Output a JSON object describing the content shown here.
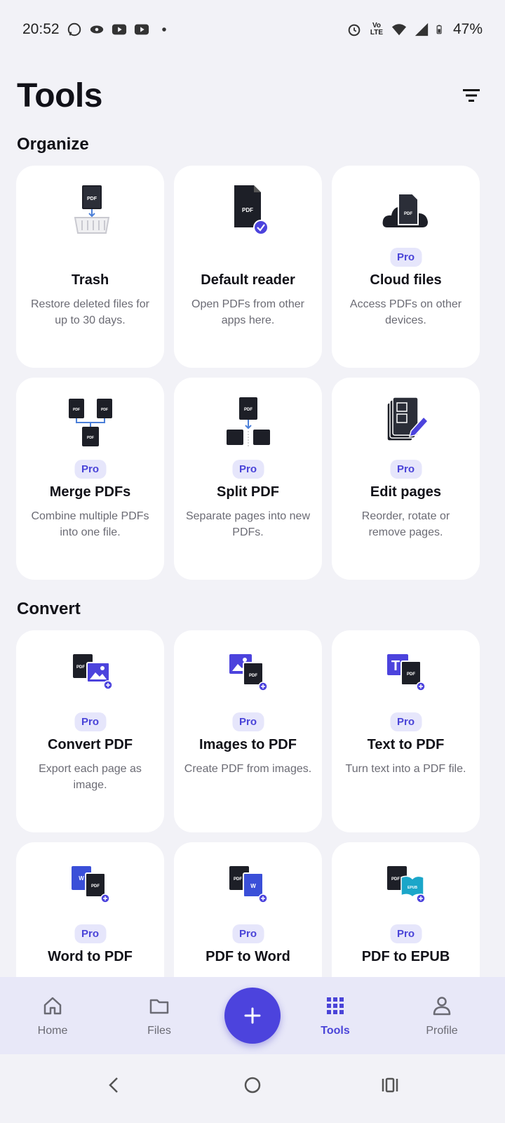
{
  "status": {
    "time": "20:52",
    "battery": "47%",
    "net": "Vo LTE"
  },
  "header": {
    "title": "Tools"
  },
  "sections": {
    "organize": "Organize",
    "convert": "Convert"
  },
  "pro_label": "Pro",
  "organize": [
    {
      "name": "Trash",
      "desc": "Restore deleted files for up to 30 days.",
      "icon": "trash-pdf-icon",
      "pro": false
    },
    {
      "name": "Default reader",
      "desc": "Open PDFs from other apps here.",
      "icon": "default-reader-icon",
      "pro": false
    },
    {
      "name": "Cloud files",
      "desc": "Access PDFs on other devices.",
      "icon": "cloud-pdf-icon",
      "pro": true
    },
    {
      "name": "Merge PDFs",
      "desc": "Combine multiple PDFs into one file.",
      "icon": "merge-pdf-icon",
      "pro": true
    },
    {
      "name": "Split PDF",
      "desc": "Separate pages into new PDFs.",
      "icon": "split-pdf-icon",
      "pro": true
    },
    {
      "name": "Edit pages",
      "desc": "Reorder, rotate or remove pages.",
      "icon": "edit-pages-icon",
      "pro": true
    }
  ],
  "convert": [
    {
      "name": "Convert PDF",
      "desc": "Export each page as image.",
      "icon": "pdf-to-image-icon",
      "pro": true
    },
    {
      "name": "Images to PDF",
      "desc": "Create PDF from images.",
      "icon": "image-to-pdf-icon",
      "pro": true
    },
    {
      "name": "Text to PDF",
      "desc": "Turn text into a PDF file.",
      "icon": "text-to-pdf-icon",
      "pro": true
    },
    {
      "name": "Word to PDF",
      "desc": "",
      "icon": "word-to-pdf-icon",
      "pro": true
    },
    {
      "name": "PDF to Word",
      "desc": "",
      "icon": "pdf-to-word-icon",
      "pro": true
    },
    {
      "name": "PDF to EPUB",
      "desc": "",
      "icon": "pdf-to-epub-icon",
      "pro": true
    }
  ],
  "icon_text": {
    "pdf": "PDF",
    "word": "W",
    "text": "T",
    "epub": "EPUB"
  },
  "nav": {
    "home": "Home",
    "files": "Files",
    "tools": "Tools",
    "profile": "Profile"
  },
  "colors": {
    "accent": "#4c43dd",
    "pro_bg": "#e6e6fb",
    "pro_text": "#4a44d8",
    "background": "#f2f2f7"
  }
}
